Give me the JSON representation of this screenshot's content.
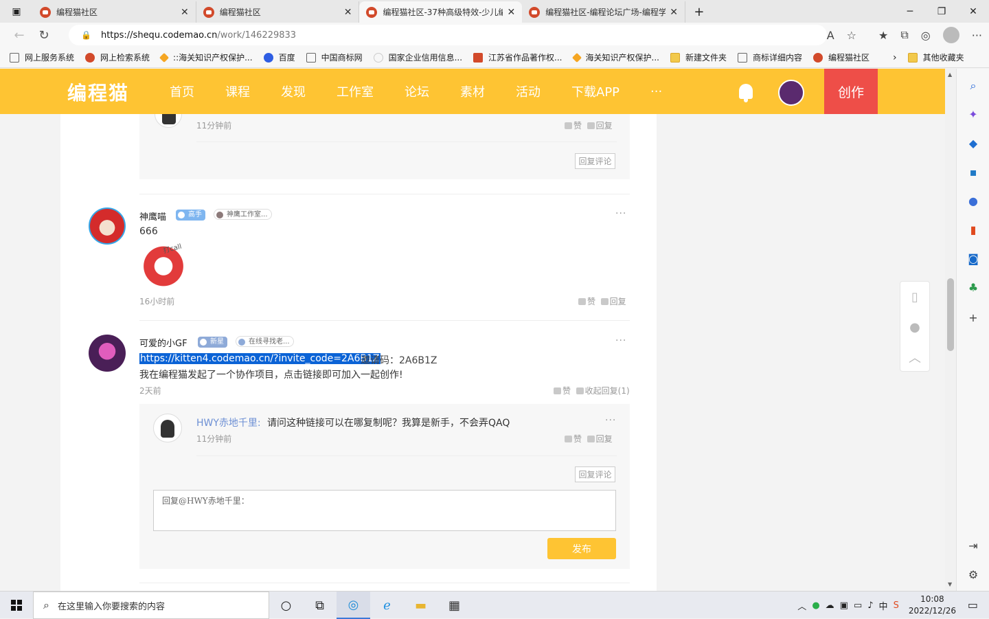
{
  "browser": {
    "tabs": [
      {
        "label": "编程猫社区",
        "active": false
      },
      {
        "label": "编程猫社区",
        "active": false
      },
      {
        "label": "编程猫社区-37种高级特效-少儿编",
        "active": true
      },
      {
        "label": "编程猫社区-编程论坛广场-编程学",
        "active": false
      }
    ],
    "new_tab": "+",
    "url_host": "https://shequ.codemao.cn",
    "url_path": "/work/146229833",
    "bookmarks": [
      "网上服务系统",
      "网上检索系统",
      "::海关知识产权保护...",
      "百度",
      "中国商标网",
      "国家企业信用信息...",
      "江苏省作品著作权...",
      "海关知识产权保护...",
      "新建文件夹",
      "商标详细内容",
      "编程猫社区"
    ],
    "other_bookmarks": "其他收藏夹"
  },
  "site": {
    "logo": "编程猫",
    "nav": [
      "首页",
      "课程",
      "发现",
      "工作室",
      "论坛",
      "素材",
      "活动",
      "下载APP",
      "···"
    ],
    "create_label": "创作"
  },
  "comments": {
    "prev_reply": {
      "time": "11分钟前",
      "like": "赞",
      "reply": "回复",
      "reply_comment": "回复评论"
    },
    "c1": {
      "user": "神鹰喵",
      "badge1": "高手",
      "badge2": "神鹰工作室...",
      "text": "666",
      "sticker_text": "打call",
      "time": "16小时前",
      "like": "赞",
      "reply": "回复",
      "more": "···"
    },
    "c2": {
      "user": "可爱的小GF",
      "badge1": "新星",
      "badge2": "在线寻找老...",
      "link": "https://kitten4.codemao.cn/?invite_code=2A6B1Z",
      "invite": "邀请码：2A6B1Z",
      "text2": "我在编程猫发起了一个协作项目，点击链接即可加入一起创作!",
      "time": "2天前",
      "like": "赞",
      "collapse": "收起回复(1)",
      "more": "···",
      "reply": {
        "user": "HWY赤地千里",
        "colon": ":",
        "text": "请问这种链接可以在哪复制呢？我算是新手，不会弄QAQ",
        "time": "11分钟前",
        "like": "赞",
        "reply": "回复",
        "more": "···"
      },
      "reply_comment": "回复评论",
      "textarea_placeholder": "回复@HWY赤地千里：",
      "publish": "发布"
    }
  },
  "taskbar": {
    "search_placeholder": "在这里输入你要搜索的内容",
    "ime": "中",
    "time": "10:08",
    "date": "2022/12/26"
  }
}
